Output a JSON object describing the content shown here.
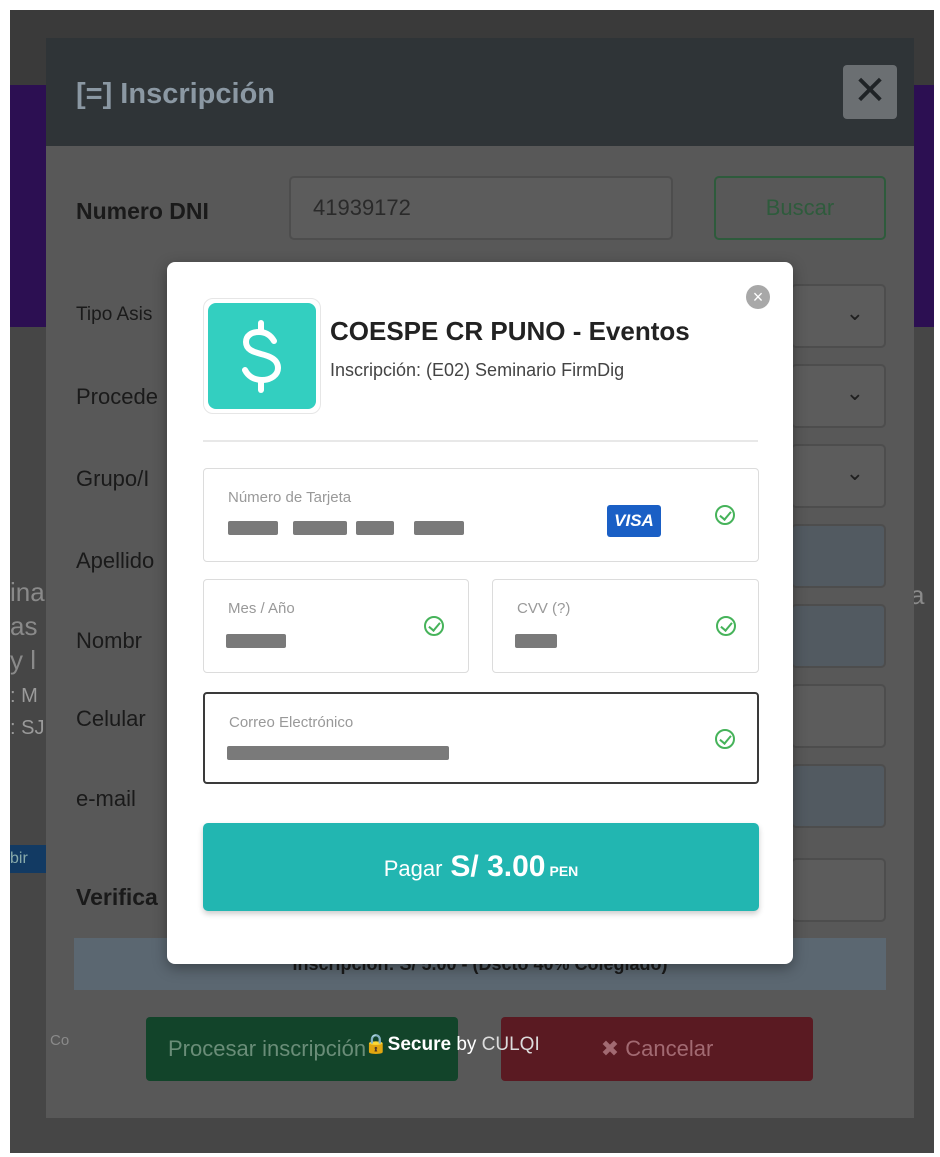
{
  "background_page": {
    "left_fragments": [
      "ina",
      "as",
      "y l",
      ": M",
      ": SJ"
    ],
    "blue_tab": "bir",
    "right_fragment": "a"
  },
  "inscripcion_modal": {
    "title": "[=] Inscripción",
    "close_symbol": "✕",
    "dni_label": "Numero DNI",
    "dni_value": "41939172",
    "search_button": "Buscar",
    "field_labels": [
      "Tipo Asis",
      "Procede",
      "Grupo/I",
      "Apellido",
      "Nombr",
      "Celular",
      "e-mail",
      "Verifica"
    ],
    "info_bar": "Inscripción: S/ 5.00 - (Dscto 40% Colegiado)",
    "left_footer": "Co",
    "process_button": "Procesar inscripción",
    "cancel_button": "✖  Cancelar"
  },
  "payment": {
    "merchant": "COESPE CR PUNO - Eventos",
    "concept": "Inscripción: (E02) Seminario FirmDig",
    "card_label": "Número de Tarjeta",
    "card_brand": "VISA",
    "expiry_label": "Mes / Año",
    "cvv_label": "CVV (?)",
    "email_label": "Correo Electrónico",
    "pay_label": "Pagar",
    "pay_amount": "S/ 3.00",
    "pay_currency": "PEN",
    "secure_prefix": "Secure",
    "secure_by": " by ",
    "secure_brand": "CULQI"
  },
  "colors": {
    "accent": "#22b6b1",
    "logo": "#33cfc0",
    "valid": "#46b35a",
    "visa": "#1a5fc5"
  }
}
